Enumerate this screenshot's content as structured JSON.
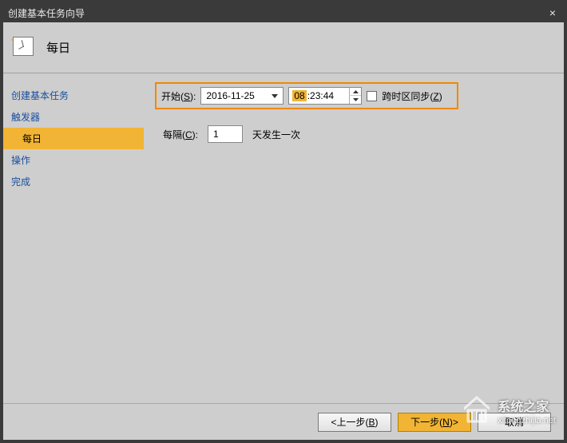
{
  "window": {
    "title": "创建基本任务向导"
  },
  "header": {
    "title": "每日"
  },
  "sidebar": {
    "items": [
      {
        "label": "创建基本任务",
        "type": "item"
      },
      {
        "label": "触发器",
        "type": "item"
      },
      {
        "label": "每日",
        "type": "sub",
        "active": true
      },
      {
        "label": "操作",
        "type": "item"
      },
      {
        "label": "完成",
        "type": "item"
      }
    ]
  },
  "form": {
    "start_label_pre": "开始(",
    "start_label_u": "S",
    "start_label_post": "):",
    "date_value": "2016-11-25",
    "time_hour": "08",
    "time_rest": ":23:44",
    "sync_label_pre": "跨时区同步(",
    "sync_label_u": "Z",
    "sync_label_post": ")",
    "interval_label_pre": "每隔(",
    "interval_label_u": "C",
    "interval_label_post": "):",
    "interval_value": "1",
    "interval_suffix": "天发生一次"
  },
  "footer": {
    "back_pre": "<上一步(",
    "back_u": "B",
    "back_post": ")",
    "next_pre": "下一步(",
    "next_u": "N",
    "next_post": ")>",
    "cancel": "取消"
  },
  "watermark": {
    "cn": "系统之家",
    "en": "xitongzhijia.net"
  }
}
